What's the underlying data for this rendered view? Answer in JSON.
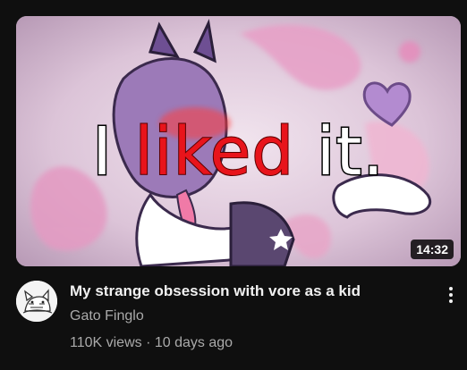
{
  "video": {
    "thumbnail_text": {
      "word1": "I",
      "word2": "liked",
      "word3": "it."
    },
    "duration": "14:32",
    "title": "My strange obsession with vore as a kid",
    "channel": "Gato Finglo",
    "views": "110K views",
    "separator": "·",
    "age": "10 days ago"
  },
  "icons": {
    "more": "more-vert-icon",
    "avatar": "channel-avatar-cat"
  },
  "colors": {
    "background": "#0f0f0f",
    "title": "#f1f1f1",
    "secondary": "#aaaaaa",
    "thumbnail_red": "#e8141b"
  }
}
